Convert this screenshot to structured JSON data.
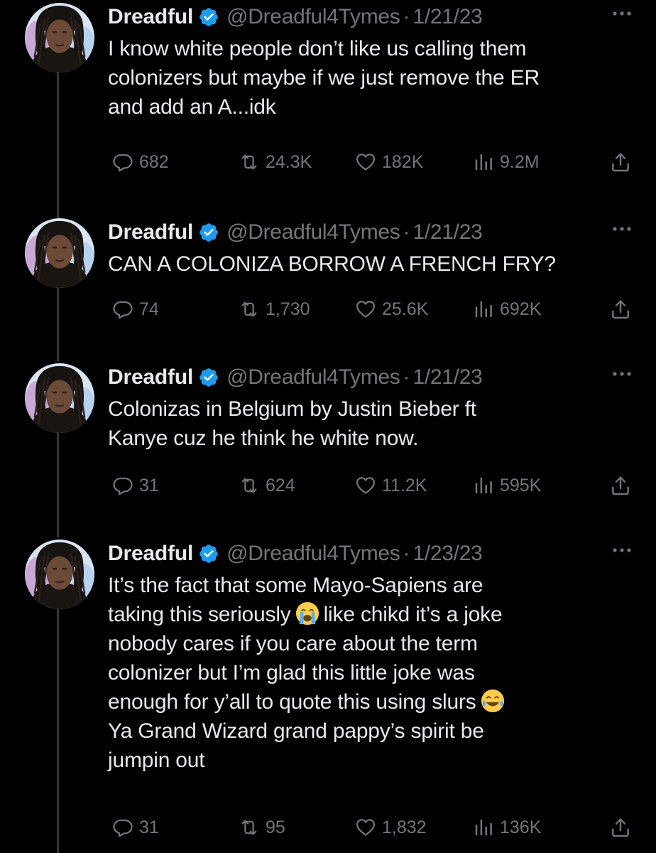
{
  "tweets": [
    {
      "name": "Dreadful",
      "handle": "@Dreadful4Tymes",
      "sep": "·",
      "date": "1/21/23",
      "lines": [
        "I know white people don’t like us calling them",
        "colonizers but maybe if we just remove the ER",
        "and add an A...idk"
      ],
      "replies": "682",
      "retweets": "24.3K",
      "likes": "182K",
      "views": "9.2M"
    },
    {
      "name": "Dreadful",
      "handle": "@Dreadful4Tymes",
      "sep": "·",
      "date": "1/21/23",
      "lines": [
        "CAN A COLONIZA BORROW A FRENCH FRY?"
      ],
      "replies": "74",
      "retweets": "1,730",
      "likes": "25.6K",
      "views": "692K"
    },
    {
      "name": "Dreadful",
      "handle": "@Dreadful4Tymes",
      "sep": "·",
      "date": "1/21/23",
      "lines": [
        "Colonizas in Belgium by Justin Bieber ft",
        "Kanye cuz he think he white now."
      ],
      "replies": "31",
      "retweets": "624",
      "likes": "11.2K",
      "views": "595K"
    },
    {
      "name": "Dreadful",
      "handle": "@Dreadful4Tymes",
      "sep": "·",
      "date": "1/23/23",
      "lines": [
        "It’s the fact that some Mayo-Sapiens  are",
        "taking this seriously",
        "like chikd it’s a joke",
        "nobody cares if you care about the term",
        "colonizer but I’m glad this little joke was",
        "enough for y’all to quote this using slurs",
        "Ya Grand Wizard grand pappy’s spirit be",
        "jumpin out"
      ],
      "replies": "31",
      "retweets": "95",
      "likes": "1,832",
      "views": "136K"
    }
  ],
  "icons": {
    "verified": "verified-badge-icon",
    "more": "more-icon",
    "reply": "reply-icon",
    "retweet": "retweet-icon",
    "like": "like-icon",
    "views": "views-icon",
    "share": "share-icon",
    "emoji_crying": "loudly-crying-face-emoji",
    "emoji_laughing": "tears-of-joy-emoji"
  },
  "colors": {
    "background": "#000000",
    "text": "#e7e9ea",
    "muted": "#71767b",
    "verified": "#1d9bf0",
    "thread_line": "#333639"
  }
}
